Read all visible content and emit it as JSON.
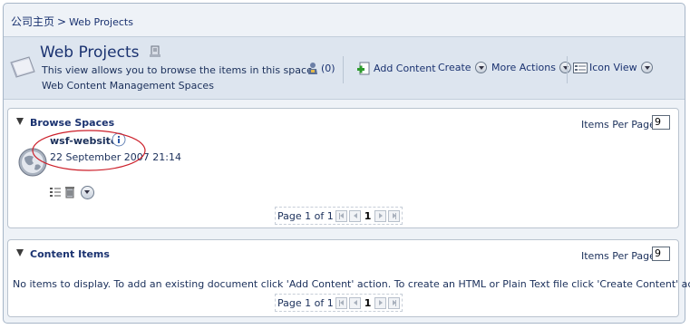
{
  "breadcrumb": {
    "home": "公司主页",
    "separator": ">",
    "current": "Web Projects"
  },
  "header": {
    "title": "Web Projects",
    "description": "This view allows you to browse the items in this space.",
    "subtitle": "Web Content Management Spaces",
    "people_count": "(0)"
  },
  "toolbar": {
    "add_content": "Add Content",
    "create": "Create",
    "more_actions": "More Actions",
    "view": "Icon View"
  },
  "browse_spaces": {
    "title": "Browse Spaces",
    "items_per_page_label": "Items Per Page",
    "items_per_page": "9",
    "items": [
      {
        "name": "wsf-website",
        "date": "22 September 2007 21:14"
      }
    ],
    "pager": {
      "label": "Page 1 of 1",
      "current": "1"
    }
  },
  "content_items": {
    "title": "Content Items",
    "items_per_page_label": "Items Per Page",
    "items_per_page": "9",
    "empty_message": "No items to display. To add an existing document click 'Add Content' action. To create an HTML or Plain Text file click 'Create Content' action.",
    "pager": {
      "label": "Page 1 of 1",
      "current": "1"
    }
  },
  "colors": {
    "accent": "#1a3270",
    "header_band": "#dde5ef",
    "highlight_ring": "#cc1f2a"
  },
  "icons": [
    "space-icon",
    "properties-icon",
    "people-icon",
    "add-content-icon",
    "view-icon",
    "globe-icon",
    "info-icon",
    "details-icon",
    "delete-icon"
  ]
}
